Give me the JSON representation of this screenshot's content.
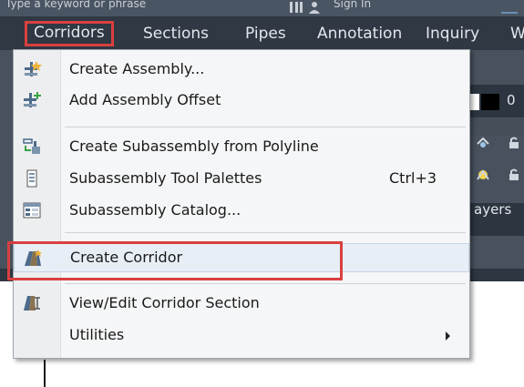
{
  "title_bar": {
    "text_left": "Type a keyword or phrase",
    "sign_in": "Sign In"
  },
  "menubar": {
    "items": [
      {
        "label": "Corridors",
        "active": true
      },
      {
        "label": "Sections"
      },
      {
        "label": "Pipes"
      },
      {
        "label": "Annotation"
      },
      {
        "label": "Inquiry"
      },
      {
        "label": "W"
      }
    ]
  },
  "ribbon": {
    "zero": "0",
    "layers_label": "ayers"
  },
  "dropdown": {
    "items": [
      {
        "label": "Create Assembly...",
        "icon": "create-assembly-icon"
      },
      {
        "label": "Add Assembly Offset",
        "icon": "add-assembly-offset-icon"
      },
      {
        "label": "Create Subassembly from Polyline",
        "icon": "subassembly-polyline-icon"
      },
      {
        "label": "Subassembly Tool Palettes",
        "shortcut": "Ctrl+3",
        "icon": "tool-palettes-icon"
      },
      {
        "label": "Subassembly Catalog...",
        "icon": "catalog-icon"
      },
      {
        "label": "Create Corridor",
        "icon": "create-corridor-icon",
        "highlighted": true
      },
      {
        "label": "View/Edit Corridor Section",
        "icon": "view-edit-corridor-icon"
      },
      {
        "label": "Utilities",
        "has_submenu": true
      }
    ]
  },
  "colors": {
    "highlight_border": "#d9403f",
    "menubar_bg": "#2f3843",
    "menu_bg": "#f5f6f7"
  }
}
